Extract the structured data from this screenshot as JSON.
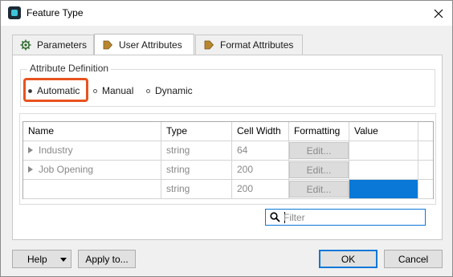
{
  "window": {
    "title": "Feature Type",
    "icon": "app-icon",
    "close_icon": "close-icon"
  },
  "tabs": [
    {
      "label": "Parameters",
      "icon": "gear-icon",
      "active": false
    },
    {
      "label": "User Attributes",
      "icon": "arrow-attribute-icon",
      "active": true
    },
    {
      "label": "Format Attributes",
      "icon": "arrow-attribute-icon",
      "active": false
    }
  ],
  "attribute_definition": {
    "label": "Attribute Definition",
    "options": [
      {
        "label": "Automatic",
        "selected": true
      },
      {
        "label": "Manual",
        "selected": false
      },
      {
        "label": "Dynamic",
        "selected": false
      }
    ],
    "highlight_color": "#e8531f"
  },
  "table": {
    "columns": [
      "Name",
      "Type",
      "Cell Width",
      "Formatting",
      "Value"
    ],
    "rows": [
      {
        "name": "Industry",
        "type": "string",
        "cell_width": "64",
        "formatting": "Edit...",
        "value": ""
      },
      {
        "name": "Job Opening",
        "type": "string",
        "cell_width": "200",
        "formatting": "Edit...",
        "value": ""
      },
      {
        "name": "",
        "type": "string",
        "cell_width": "200",
        "formatting": "Edit...",
        "value": ""
      }
    ],
    "selected_value_color": "#0a78d7"
  },
  "filter": {
    "placeholder": "Filter",
    "value": ""
  },
  "buttons": {
    "help": "Help",
    "apply": "Apply to...",
    "ok": "OK",
    "cancel": "Cancel"
  },
  "colors": {
    "accent": "#0a78d7",
    "highlight": "#e8531f"
  }
}
